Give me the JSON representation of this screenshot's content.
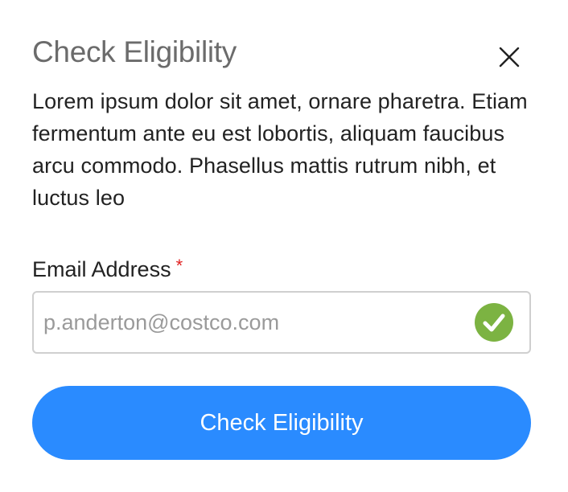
{
  "modal": {
    "title": "Check Eligibility",
    "description": "Lorem ipsum dolor sit amet, ornare pharetra. Etiam fermentum ante eu est lobortis, aliquam faucibus arcu commodo. Phasellus mattis rutrum nibh, et luctus leo",
    "close_icon": "close-icon"
  },
  "form": {
    "email_label": "Email Address",
    "required_mark": "*",
    "email_value": "p.anderton@costco.com",
    "valid_icon": "check-circle-icon",
    "submit_label": "Check Eligibility"
  },
  "colors": {
    "primary": "#2a8bff",
    "success": "#7cb342",
    "required": "#e02020",
    "title": "#6b6b6b"
  }
}
